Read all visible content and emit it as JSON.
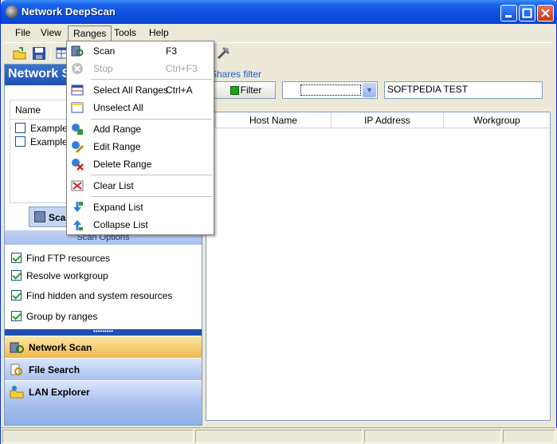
{
  "window": {
    "title": "Network DeepScan"
  },
  "menubar": [
    "File",
    "View",
    "Ranges",
    "Tools",
    "Help"
  ],
  "left": {
    "header": "Network S",
    "list_header": "Name",
    "items": [
      "Example 1",
      "Example 2"
    ],
    "scan_button": "Scan",
    "options_header": "Scan Options",
    "options": [
      {
        "label": "Find FTP resources",
        "checked": true
      },
      {
        "label": "Resolve workgroup",
        "checked": true
      },
      {
        "label": "Find hidden and system resources",
        "checked": true
      },
      {
        "label": "Group by ranges",
        "checked": true
      }
    ],
    "nav": [
      "Network Scan",
      "File Search",
      "LAN Explorer"
    ]
  },
  "right": {
    "filter_group": "Shares filter",
    "filter_button": "Filter",
    "filter_text": "SOFTPEDIA TEST",
    "columns": [
      "Host Name",
      "IP Address",
      "Workgroup"
    ]
  },
  "dropdown": {
    "items": [
      {
        "label": "Scan",
        "shortcut": "F3"
      },
      {
        "label": "Stop",
        "shortcut": "Ctrl+F3",
        "disabled": true
      },
      {
        "label": "Select All Ranges",
        "shortcut": "Ctrl+A"
      },
      {
        "label": "Unselect All",
        "shortcut": ""
      },
      {
        "label": "Add Range",
        "shortcut": ""
      },
      {
        "label": "Edit Range",
        "shortcut": ""
      },
      {
        "label": "Delete Range",
        "shortcut": ""
      },
      {
        "label": "Clear List",
        "shortcut": ""
      },
      {
        "label": "Expand List",
        "shortcut": ""
      },
      {
        "label": "Collapse List",
        "shortcut": ""
      }
    ]
  },
  "colors": {
    "accent": "#1d4fb5",
    "title_bar": "#0a4fe0",
    "nav_active": "#f1b94a"
  }
}
